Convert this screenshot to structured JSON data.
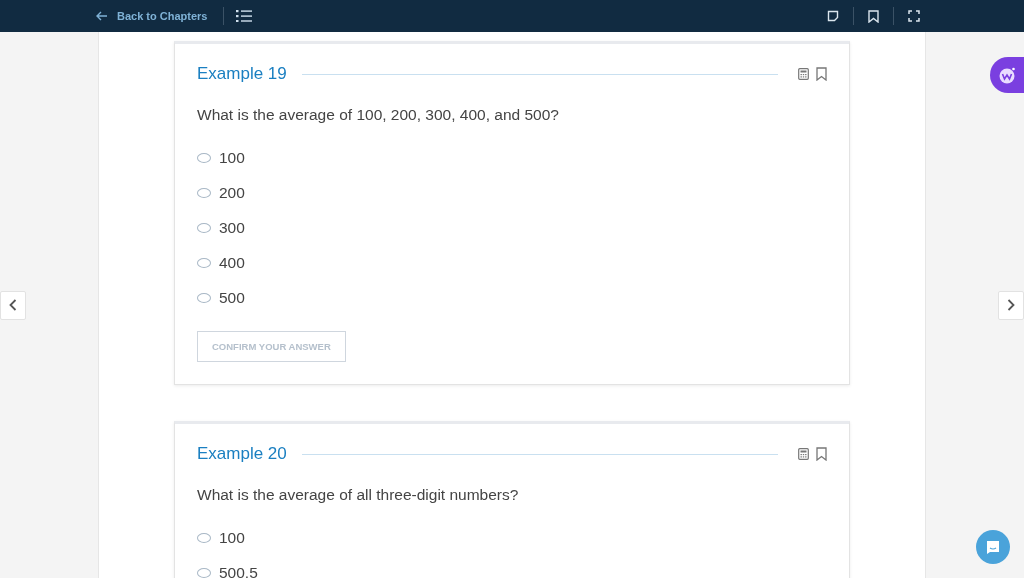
{
  "topbar": {
    "back_link": "Back to Chapters"
  },
  "examples": [
    {
      "title": "Example 19",
      "question": "What is the average of 100, 200, 300, 400, and 500?",
      "options": [
        {
          "label": "100",
          "selected": false
        },
        {
          "label": "200",
          "selected": false
        },
        {
          "label": "300",
          "selected": false
        },
        {
          "label": "400",
          "selected": false
        },
        {
          "label": "500",
          "selected": false
        }
      ],
      "confirm_button": {
        "label": "CONFIRM YOUR ANSWER",
        "disabled": true
      }
    },
    {
      "title": "Example 20",
      "question": "What is the average of all three-digit numbers?",
      "options": [
        {
          "label": "100",
          "selected": false
        },
        {
          "label": "500.5",
          "selected": false
        }
      ]
    }
  ]
}
